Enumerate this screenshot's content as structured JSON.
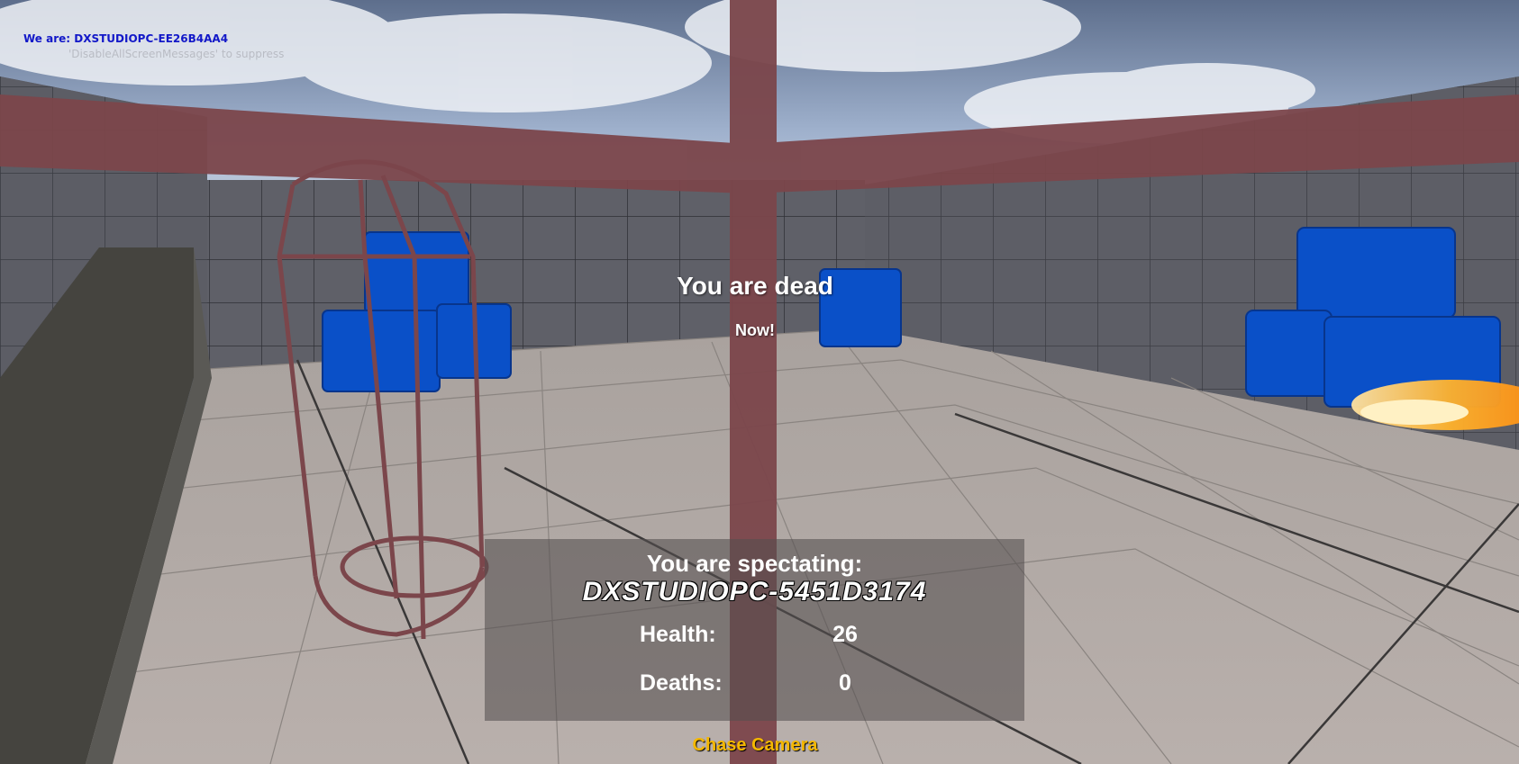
{
  "debug": {
    "line1": "We are: DXSTUDIOPC-EE26B4AA4",
    "line2": "'DisableAllScreenMessages' to suppress"
  },
  "status": {
    "title": "You are dead",
    "subtitle": "Now!"
  },
  "spectate": {
    "title": "You are spectating:",
    "player_name": "DXSTUDIOPC-5451D3174",
    "health_label": "Health:",
    "health_value": "26",
    "deaths_label": "Deaths:",
    "deaths_value": "0"
  },
  "camera_mode": "Chase Camera",
  "colors": {
    "debug_name": "#1218c8",
    "camera_mode": "#f5b800",
    "crosshair": "#7b464b",
    "cube": "#0a50c8"
  }
}
